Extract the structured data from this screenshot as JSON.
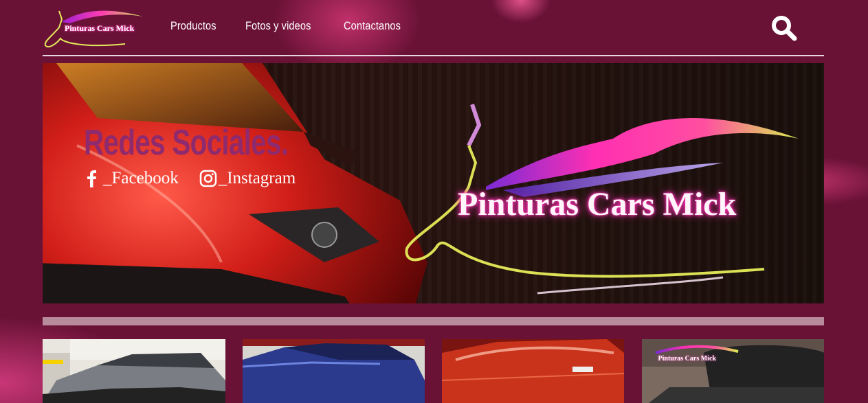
{
  "header": {
    "logo_text": "Pinturas Cars Mick",
    "nav": [
      {
        "label": "Productos"
      },
      {
        "label": "Fotos y videos"
      },
      {
        "label": "Contactanos"
      }
    ],
    "search_icon": "search-icon"
  },
  "banner": {
    "social_title": "Redes Sociales.",
    "facebook_label": "_Facebook",
    "instagram_label": "_Instagram",
    "brand_text": "Pinturas Cars Mick"
  },
  "gallery": {
    "watermark_text": "Pinturas Cars Mick"
  },
  "colors": {
    "background": "#6a1236",
    "social_title": "#8e2a6d",
    "divider": "#b78a9c",
    "glow": "#ff2fb2"
  }
}
